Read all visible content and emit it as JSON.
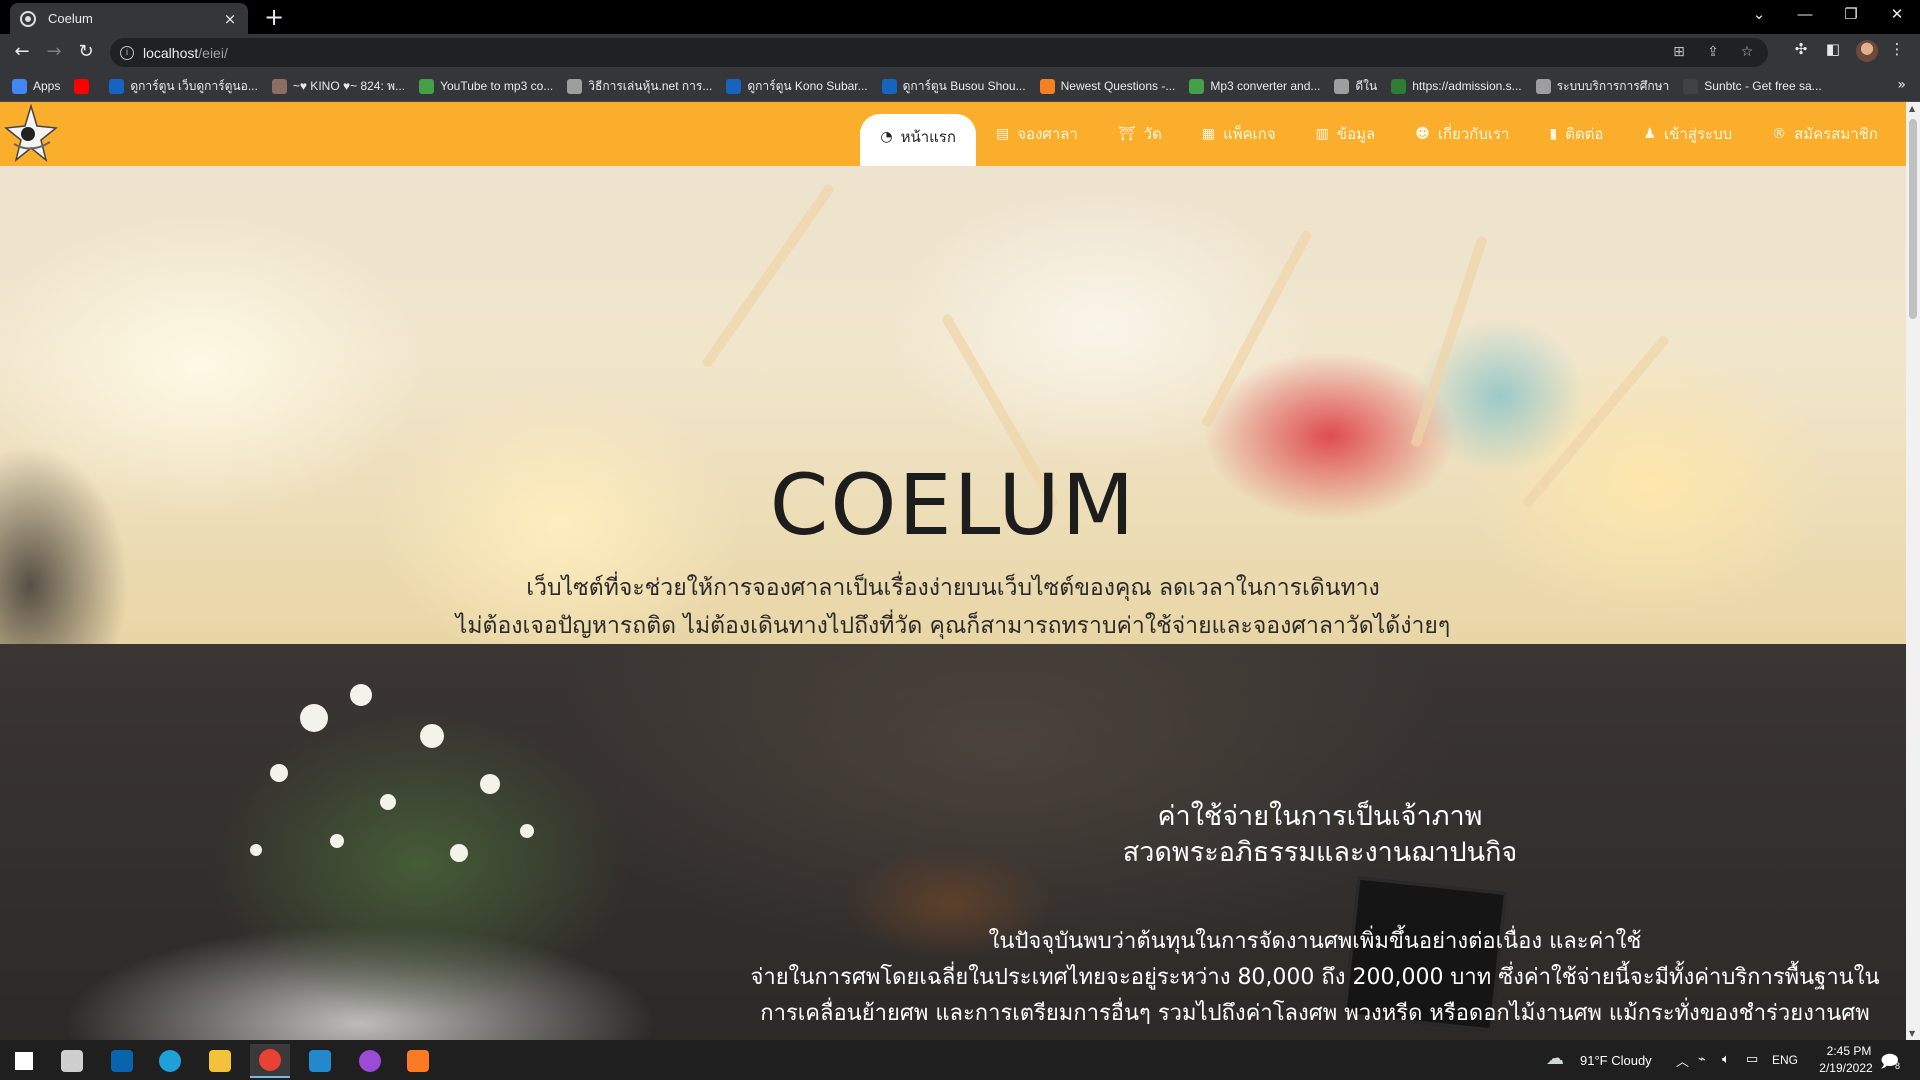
{
  "browser": {
    "tab_title": "Coelum",
    "tab_close": "×",
    "new_tab": "+",
    "url_host": "localhost",
    "url_path": "/eiei/",
    "info_glyph": "i",
    "window_controls": [
      "⌄",
      "—",
      "❐",
      "✕"
    ],
    "bookmarks": [
      {
        "label": "Apps",
        "icon": "apps-grid-icon",
        "color": "#4285f4"
      },
      {
        "label": "",
        "icon": "youtube-icon",
        "color": "#ff0000"
      },
      {
        "label": "ดูการ์ตูน เว็บดูการ์ตูนอ...",
        "icon": "ka-icon",
        "color": "#1565c0"
      },
      {
        "label": "~♥ KINO ♥~ 824: พ...",
        "icon": "kino-icon",
        "color": "#8d6e63"
      },
      {
        "label": "YouTube to mp3 co...",
        "icon": "mp3-icon",
        "color": "#43a047"
      },
      {
        "label": "วิธีการเล่นหุ้น.net การ...",
        "icon": "globe-icon",
        "color": "#9e9e9e"
      },
      {
        "label": "ดูการ์ตูน Kono Subar...",
        "icon": "ka-icon",
        "color": "#1565c0"
      },
      {
        "label": "ดูการ์ตูน Busou Shou...",
        "icon": "ka-icon",
        "color": "#1565c0"
      },
      {
        "label": "Newest Questions -...",
        "icon": "stackoverflow-icon",
        "color": "#f48024"
      },
      {
        "label": "Mp3 converter and...",
        "icon": "mp3-icon",
        "color": "#43a047"
      },
      {
        "label": "ดีใน",
        "icon": "globe-icon",
        "color": "#9e9e9e"
      },
      {
        "label": "https://admission.s...",
        "icon": "su-icon",
        "color": "#2e7d32"
      },
      {
        "label": "ระบบบริการการศึกษา",
        "icon": "globe-icon",
        "color": "#9e9e9e"
      },
      {
        "label": "Sunbtc - Get free sa...",
        "icon": "sunbtc-icon",
        "color": "#424242"
      }
    ],
    "bookmarks_more": "»"
  },
  "site": {
    "brand_color": "#fbae2b",
    "nav": [
      {
        "label": "หน้าแรก",
        "icon": "dashboard-icon",
        "glyph": "◔",
        "active": true
      },
      {
        "label": "จองศาลา",
        "icon": "booking-icon",
        "glyph": "▤",
        "active": false
      },
      {
        "label": "วัด",
        "icon": "temple-icon",
        "glyph": "⛩",
        "active": false
      },
      {
        "label": "แพ็คเกจ",
        "icon": "calendar-icon",
        "glyph": "▦",
        "active": false
      },
      {
        "label": "ข้อมูล",
        "icon": "chart-icon",
        "glyph": "▥",
        "active": false
      },
      {
        "label": "เกี่ยวกับเรา",
        "icon": "users-icon",
        "glyph": "☻",
        "active": false
      },
      {
        "label": "ติดต่อ",
        "icon": "contact-icon",
        "glyph": "▮",
        "active": false
      },
      {
        "label": "เข้าสู่ระบบ",
        "icon": "user-icon",
        "glyph": "♟",
        "active": false
      },
      {
        "label": "สมัครสมาชิก",
        "icon": "register-icon",
        "glyph": "®",
        "active": false
      }
    ],
    "hero": {
      "title": "COELUM",
      "line1": "เว็บไซต์ที่จะช่วยให้การจองศาลาเป็นเรื่องง่ายบนเว็บไซต์ของคุณ ลดเวลาในการเดินทาง",
      "line2": "ไม่ต้องเจอปัญหารถติด ไม่ต้องเดินทางไปถึงที่วัด คุณก็สามารถทราบค่าใช้จ่ายและจองศาลาวัดได้ง่ายๆ"
    },
    "section2": {
      "title_line1": "ค่าใช้จ่ายในการเป็นเจ้าภาพ",
      "title_line2": "สวดพระอภิธรรมและงานฌาปนกิจ",
      "text_line1": "ในปัจจุบันพบว่าต้นทุนในการจัดงานศพเพิ่มขึ้นอย่างต่อเนื่อง และค่าใช้",
      "text_line2": "จ่ายในการศพโดยเฉลี่ยในประเทศไทยจะอยู่ระหว่าง 80,000 ถึง 200,000 บาท ซึ่งค่าใช้จ่ายนี้จะมีทั้งค่าบริการพื้นฐานใน",
      "text_line3": "การเคลื่อนย้ายศพ และการเตรียมการอื่นๆ รวมไปถึงค่าโลงศพ พวงหรีด หรือดอกไม้งานศพ แม้กระทั่งของชำร่วยงานศพ"
    }
  },
  "taskbar": {
    "weather": "91°F  Cloudy",
    "language": "ENG",
    "time": "2:45 PM",
    "date": "2/19/2022",
    "notification_count": "8",
    "apps": [
      {
        "name": "start-button",
        "color": "#ffffff"
      },
      {
        "name": "task-view-button",
        "color": "#cfcfcf"
      },
      {
        "name": "outlook-app",
        "color": "#0a64ad"
      },
      {
        "name": "edge-app",
        "color": "#1fa0d8"
      },
      {
        "name": "file-explorer-app",
        "color": "#f3c13a"
      },
      {
        "name": "chrome-app",
        "color": "#e94235"
      },
      {
        "name": "vscode-app",
        "color": "#2489ca"
      },
      {
        "name": "messenger-app",
        "color": "#9c4bd6"
      },
      {
        "name": "xampp-app",
        "color": "#fb7a24"
      }
    ]
  }
}
